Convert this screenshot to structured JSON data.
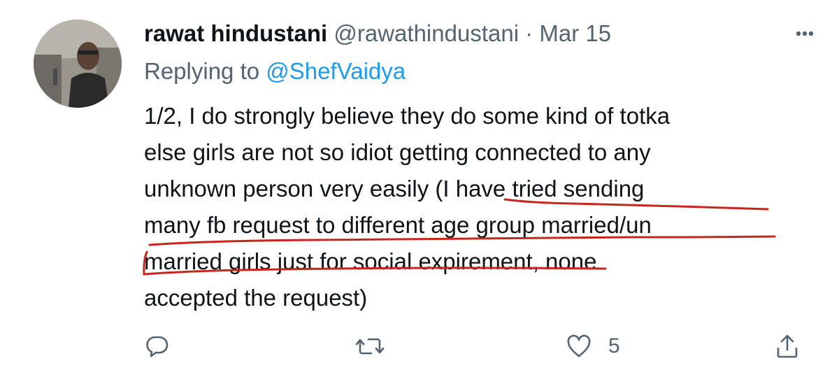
{
  "tweet": {
    "author_name": "rawat hindustani",
    "author_handle": "@rawathindustani",
    "separator": "·",
    "date": "Mar 15",
    "replying_prefix": "Replying to ",
    "replying_to": "@ShefVaidya",
    "body_lines": {
      "l1": "1/2, I do strongly believe they do some kind of totka",
      "l2": "else girls are not so idiot getting connected to any",
      "l3_plain": "unknown person very easily ",
      "l3_underlined": "(I have tried sending",
      "l4": "many fb request to different age group married/un",
      "l5_underlined": "married girls just for social expirement",
      "l5_rest": ", none",
      "l6": "accepted the request)"
    }
  },
  "actions": {
    "reply_icon": "reply-bubble-icon",
    "retweet_icon": "retweet-icon",
    "like_icon": "heart-icon",
    "like_count": "5",
    "share_icon": "share-icon"
  },
  "colors": {
    "text": "#0f1419",
    "secondary": "#536471",
    "link": "#1d9bf0",
    "annotation_red": "#c8261d",
    "icon": "#536471"
  }
}
